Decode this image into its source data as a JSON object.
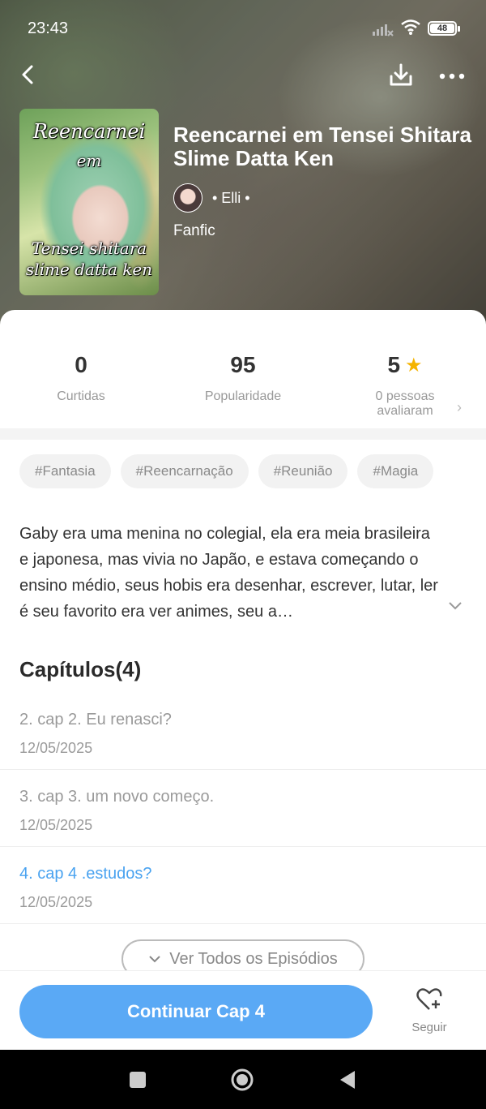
{
  "status_bar": {
    "time": "23:43",
    "battery": "48"
  },
  "book": {
    "title": "Reencarnei em Tensei Shitara Slime Datta Ken",
    "author": "• Elli •",
    "genre": "Fanfic",
    "cover_text": [
      "Reencarnei",
      "em",
      "Tensei shitara",
      "slime datta ken"
    ]
  },
  "stats": [
    {
      "value": "0",
      "label": "Curtidas"
    },
    {
      "value": "95",
      "label": "Popularidade"
    },
    {
      "value": "5",
      "label_line1": "0 pessoas",
      "label_line2": "avaliaram"
    }
  ],
  "tags": [
    "#Fantasia",
    "#Reencarnação",
    "#Reunião",
    "#Magia"
  ],
  "synopsis": "Gaby era uma menina no colegial, ela era meia brasileira e japonesa, mas vivia no Japão, e estava começando o ensino médio, seus hobis era desenhar, escrever, lutar, ler é seu favorito era ver animes, seu a…",
  "chapters": {
    "heading": "Capítulos(4)",
    "items": [
      {
        "title": "2. cap 2. Eu renasci?",
        "date": "12/05/2025"
      },
      {
        "title": "3. cap 3. um novo começo.",
        "date": "12/05/2025"
      },
      {
        "title": "4. cap 4 .estudos?",
        "date": "12/05/2025"
      }
    ],
    "view_all": "Ver Todos os Episódios"
  },
  "actions": {
    "continue": "Continuar Cap 4",
    "follow": "Seguir"
  },
  "colors": {
    "accent": "#5aa9f5",
    "current_chapter": "#4aa3f0",
    "star": "#f5b400"
  },
  "icons": [
    "back-arrow-icon",
    "download-icon",
    "more-dots-icon",
    "star-icon",
    "chevron-right-icon",
    "chevron-down-icon",
    "heart-plus-icon",
    "square-icon",
    "circle-icon",
    "triangle-back-icon"
  ]
}
